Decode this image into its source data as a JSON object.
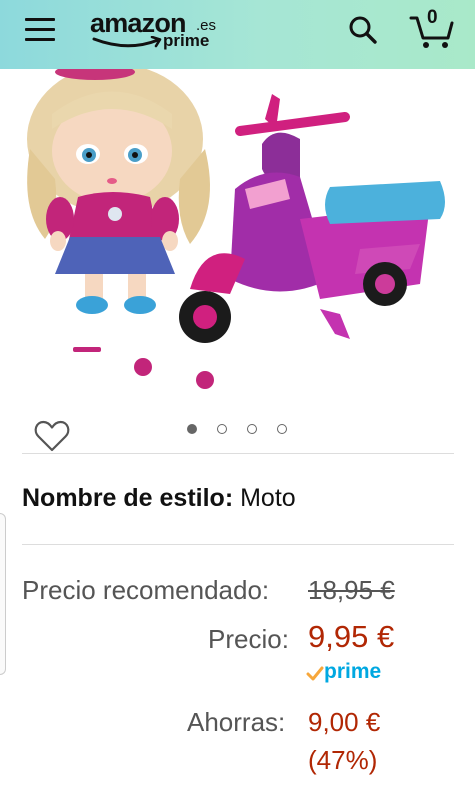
{
  "header": {
    "logo_main": "amazon",
    "logo_tld": ".es",
    "logo_sub": "prime",
    "cart_count": "0",
    "icons": {
      "menu": "hamburger-menu-icon",
      "search": "search-icon",
      "cart": "cart-icon"
    },
    "gradient_colors": [
      "#8dd9dc",
      "#a9e9c9"
    ]
  },
  "product": {
    "image_description_icon": "doll-with-scooter-image",
    "wishlist_icon": "heart-outline-icon",
    "carousel": {
      "count": 4,
      "active_index": 0
    }
  },
  "style": {
    "label": "Nombre de estilo:",
    "value": "Moto"
  },
  "pricing": {
    "list_label": "Precio recomendado:",
    "list_price": "18,95 €",
    "price_label": "Precio:",
    "price": "9,95 €",
    "prime_label": "prime",
    "savings_label": "Ahorras:",
    "savings_amount": "9,00 €",
    "savings_percent": "(47%)",
    "accent_color": "#b12704",
    "prime_color": "#00a8e1"
  }
}
